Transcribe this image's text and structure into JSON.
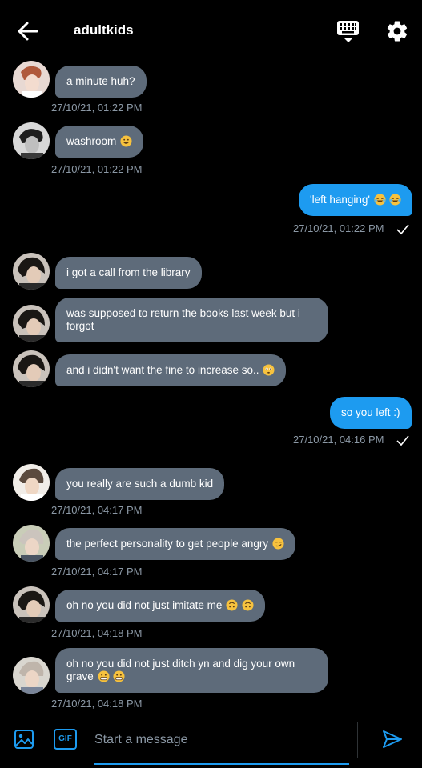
{
  "header": {
    "title": "adultkids",
    "back_icon": "arrow-left-icon",
    "keyboard_icon": "keyboard-icon",
    "settings_icon": "gear-icon"
  },
  "colors": {
    "background": "#000000",
    "incoming_bubble": "#5e6b7a",
    "outgoing_bubble": "#1d9bf0",
    "timestamp": "#8b98a5",
    "accent": "#1d9bf0"
  },
  "messages": [
    {
      "direction": "in",
      "text": "a minute huh?",
      "timestamp": "27/10/21, 01:22 PM"
    },
    {
      "direction": "in",
      "text": "washroom",
      "emoji": "grinning-face-emoji",
      "timestamp": "27/10/21, 01:22 PM"
    },
    {
      "direction": "out",
      "text": "'left hanging' ",
      "emoji": "laughing-crying-faces-emoji",
      "timestamp": "27/10/21, 01:22 PM",
      "status_icon": "checkmark-icon"
    },
    {
      "direction": "in",
      "text": "i got a call from the library"
    },
    {
      "direction": "in",
      "text": "was supposed to return the books last week but i forgot"
    },
    {
      "direction": "in",
      "text": "and i didn't want the fine to increase so..",
      "emoji": "flushed-face-emoji"
    },
    {
      "direction": "out",
      "text": "so you left :)",
      "timestamp": "27/10/21, 04:16 PM",
      "status_icon": "checkmark-icon"
    },
    {
      "direction": "in",
      "text": "you really are such a dumb kid",
      "timestamp": "27/10/21, 04:17 PM"
    },
    {
      "direction": "in",
      "text": "the perfect personality to get people angry",
      "emoji": "smirking-face-emoji",
      "timestamp": "27/10/21, 04:17 PM"
    },
    {
      "direction": "in",
      "text": "oh no you did not just imitate me ",
      "emoji": "upside-down-faces-emoji",
      "timestamp": "27/10/21, 04:18 PM"
    },
    {
      "direction": "in",
      "text": "oh no you did not just ditch yn and dig your own grave ",
      "emoji": "grimacing-faces-emoji",
      "timestamp": "27/10/21, 04:18 PM"
    }
  ],
  "composer": {
    "placeholder": "Start a message",
    "gif_label": "GIF",
    "image_icon": "image-icon",
    "send_icon": "send-icon"
  }
}
